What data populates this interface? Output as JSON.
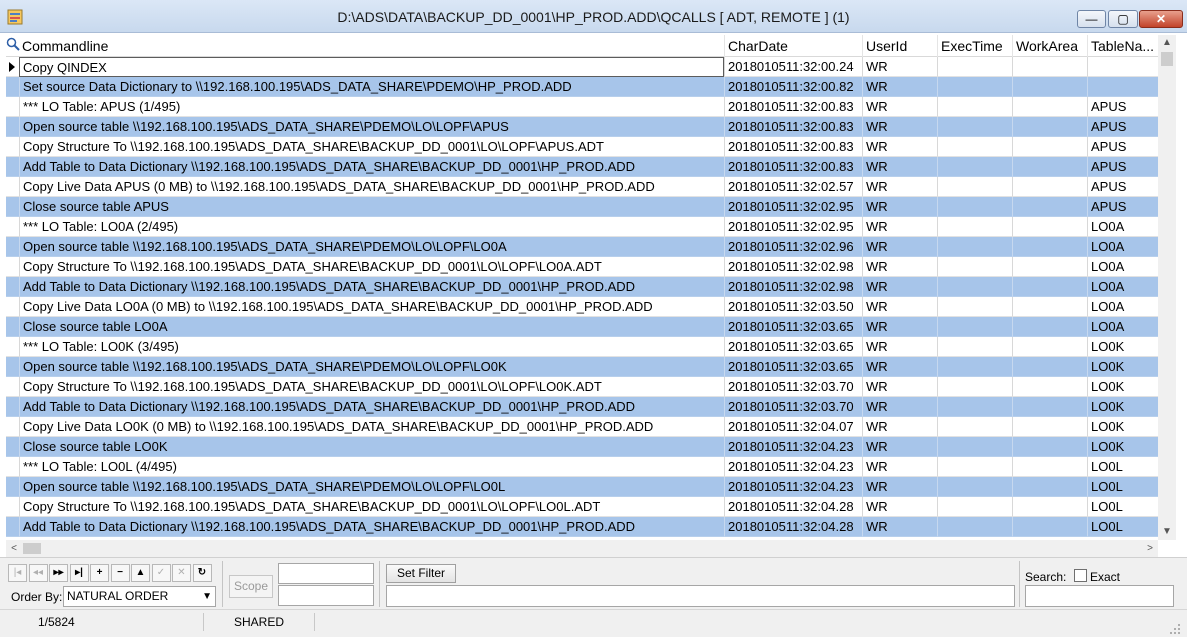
{
  "window": {
    "title": "D:\\ADS\\DATA\\BACKUP_DD_0001\\HP_PROD.ADD\\QCALLS [ ADT, REMOTE ] (1)",
    "minimize_glyph": "—",
    "maximize_glyph": "▢",
    "close_glyph": "✕"
  },
  "grid": {
    "columns": [
      "Commandline",
      "CharDate",
      "UserId",
      "ExecTime",
      "WorkArea",
      "TableNa..."
    ],
    "rows": [
      {
        "cmd": "Copy QINDEX",
        "date": "2018010511:32:00.24",
        "user": "WR",
        "table": ""
      },
      {
        "cmd": "Set source Data Dictionary to \\\\192.168.100.195\\ADS_DATA_SHARE\\PDEMO\\HP_PROD.ADD",
        "date": "2018010511:32:00.82",
        "user": "WR",
        "table": ""
      },
      {
        "cmd": "*** LO Table: APUS  (1/495)",
        "date": "2018010511:32:00.83",
        "user": "WR",
        "table": "APUS"
      },
      {
        "cmd": "Open source table \\\\192.168.100.195\\ADS_DATA_SHARE\\PDEMO\\LO\\LOPF\\APUS",
        "date": "2018010511:32:00.83",
        "user": "WR",
        "table": "APUS"
      },
      {
        "cmd": "Copy Structure To \\\\192.168.100.195\\ADS_DATA_SHARE\\BACKUP_DD_0001\\LO\\LOPF\\APUS.ADT",
        "date": "2018010511:32:00.83",
        "user": "WR",
        "table": "APUS"
      },
      {
        "cmd": "Add Table to Data Dictionary \\\\192.168.100.195\\ADS_DATA_SHARE\\BACKUP_DD_0001\\HP_PROD.ADD",
        "date": "2018010511:32:00.83",
        "user": "WR",
        "table": "APUS"
      },
      {
        "cmd": "Copy Live Data APUS (0 MB) to \\\\192.168.100.195\\ADS_DATA_SHARE\\BACKUP_DD_0001\\HP_PROD.ADD",
        "date": "2018010511:32:02.57",
        "user": "WR",
        "table": "APUS"
      },
      {
        "cmd": "Close source table APUS",
        "date": "2018010511:32:02.95",
        "user": "WR",
        "table": "APUS"
      },
      {
        "cmd": "*** LO Table: LO0A  (2/495)",
        "date": "2018010511:32:02.95",
        "user": "WR",
        "table": "LO0A"
      },
      {
        "cmd": "Open source table \\\\192.168.100.195\\ADS_DATA_SHARE\\PDEMO\\LO\\LOPF\\LO0A",
        "date": "2018010511:32:02.96",
        "user": "WR",
        "table": "LO0A"
      },
      {
        "cmd": "Copy Structure To \\\\192.168.100.195\\ADS_DATA_SHARE\\BACKUP_DD_0001\\LO\\LOPF\\LO0A.ADT",
        "date": "2018010511:32:02.98",
        "user": "WR",
        "table": "LO0A"
      },
      {
        "cmd": "Add Table to Data Dictionary \\\\192.168.100.195\\ADS_DATA_SHARE\\BACKUP_DD_0001\\HP_PROD.ADD",
        "date": "2018010511:32:02.98",
        "user": "WR",
        "table": "LO0A"
      },
      {
        "cmd": "Copy Live Data LO0A (0 MB) to \\\\192.168.100.195\\ADS_DATA_SHARE\\BACKUP_DD_0001\\HP_PROD.ADD",
        "date": "2018010511:32:03.50",
        "user": "WR",
        "table": "LO0A"
      },
      {
        "cmd": "Close source table LO0A",
        "date": "2018010511:32:03.65",
        "user": "WR",
        "table": "LO0A"
      },
      {
        "cmd": "*** LO Table: LO0K  (3/495)",
        "date": "2018010511:32:03.65",
        "user": "WR",
        "table": "LO0K"
      },
      {
        "cmd": "Open source table \\\\192.168.100.195\\ADS_DATA_SHARE\\PDEMO\\LO\\LOPF\\LO0K",
        "date": "2018010511:32:03.65",
        "user": "WR",
        "table": "LO0K"
      },
      {
        "cmd": "Copy Structure To \\\\192.168.100.195\\ADS_DATA_SHARE\\BACKUP_DD_0001\\LO\\LOPF\\LO0K.ADT",
        "date": "2018010511:32:03.70",
        "user": "WR",
        "table": "LO0K"
      },
      {
        "cmd": "Add Table to Data Dictionary \\\\192.168.100.195\\ADS_DATA_SHARE\\BACKUP_DD_0001\\HP_PROD.ADD",
        "date": "2018010511:32:03.70",
        "user": "WR",
        "table": "LO0K"
      },
      {
        "cmd": "Copy Live Data LO0K (0 MB) to \\\\192.168.100.195\\ADS_DATA_SHARE\\BACKUP_DD_0001\\HP_PROD.ADD",
        "date": "2018010511:32:04.07",
        "user": "WR",
        "table": "LO0K"
      },
      {
        "cmd": "Close source table LO0K",
        "date": "2018010511:32:04.23",
        "user": "WR",
        "table": "LO0K"
      },
      {
        "cmd": "*** LO Table: LO0L  (4/495)",
        "date": "2018010511:32:04.23",
        "user": "WR",
        "table": "LO0L"
      },
      {
        "cmd": "Open source table \\\\192.168.100.195\\ADS_DATA_SHARE\\PDEMO\\LO\\LOPF\\LO0L",
        "date": "2018010511:32:04.23",
        "user": "WR",
        "table": "LO0L"
      },
      {
        "cmd": "Copy Structure To \\\\192.168.100.195\\ADS_DATA_SHARE\\BACKUP_DD_0001\\LO\\LOPF\\LO0L.ADT",
        "date": "2018010511:32:04.28",
        "user": "WR",
        "table": "LO0L"
      },
      {
        "cmd": "Add Table to Data Dictionary \\\\192.168.100.195\\ADS_DATA_SHARE\\BACKUP_DD_0001\\HP_PROD.ADD",
        "date": "2018010511:32:04.28",
        "user": "WR",
        "table": "LO0L"
      }
    ],
    "row_colors": {
      "alt": "#a7c5ea",
      "normal": "#ffffff"
    }
  },
  "scrollbars": {
    "up_glyph": "▲",
    "down_glyph": "▼",
    "left_glyph": "<",
    "right_glyph": ">"
  },
  "nav_buttons": [
    {
      "icon": "first-icon",
      "glyph": "|◂",
      "enabled": false
    },
    {
      "icon": "prior-icon",
      "glyph": "◂◂",
      "enabled": false
    },
    {
      "icon": "next-icon",
      "glyph": "▸▸",
      "enabled": true
    },
    {
      "icon": "last-icon",
      "glyph": "▸|",
      "enabled": true
    },
    {
      "icon": "insert-icon",
      "glyph": "+",
      "enabled": true
    },
    {
      "icon": "delete-icon",
      "glyph": "−",
      "enabled": true
    },
    {
      "icon": "edit-icon",
      "glyph": "▲",
      "enabled": true
    },
    {
      "icon": "post-icon",
      "glyph": "✓",
      "enabled": false
    },
    {
      "icon": "cancel-icon",
      "glyph": "✕",
      "enabled": false
    },
    {
      "icon": "refresh-icon",
      "glyph": "↻",
      "enabled": true
    }
  ],
  "controls": {
    "order_by_label": "Order By:",
    "order_by_value": "NATURAL ORDER",
    "scope_label": "Scope",
    "set_filter_label": "Set Filter",
    "search_label": "Search:",
    "exact_label": "Exact"
  },
  "status": {
    "record": "1/5824",
    "mode": "SHARED"
  }
}
